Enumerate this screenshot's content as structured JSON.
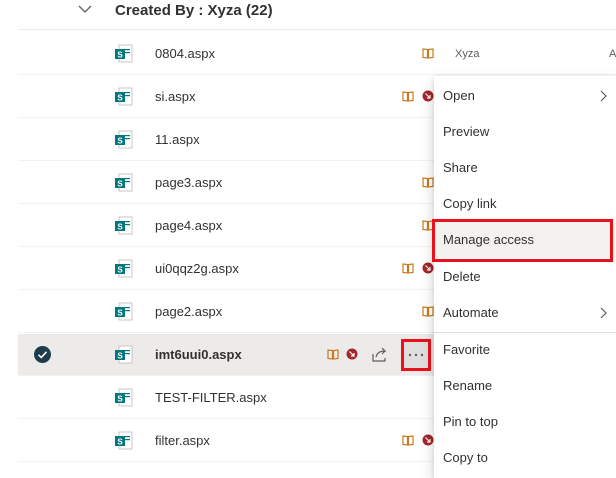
{
  "group": {
    "title": "Created By : Xyza (22)"
  },
  "rows": [
    {
      "name": "0804.aspx",
      "modified_by": "Xyza",
      "col_au": "Au"
    },
    {
      "name": "si.aspx"
    },
    {
      "name": "11.aspx"
    },
    {
      "name": "page3.aspx"
    },
    {
      "name": "page4.aspx"
    },
    {
      "name": "ui0qqz2g.aspx"
    },
    {
      "name": "page2.aspx"
    },
    {
      "name": "imt6uui0.aspx",
      "selected": true
    },
    {
      "name": "TEST-FILTER.aspx"
    },
    {
      "name": "filter.aspx"
    }
  ],
  "context_menu": {
    "items": [
      {
        "label": "Open",
        "has_submenu": true
      },
      {
        "label": "Preview"
      },
      {
        "label": "Share"
      },
      {
        "label": "Copy link"
      },
      {
        "label": "Manage access",
        "highlighted": true
      },
      {
        "label": "Delete"
      },
      {
        "label": "Automate",
        "has_submenu": true
      },
      {
        "label": "Favorite"
      },
      {
        "label": "Rename"
      },
      {
        "label": "Pin to top"
      },
      {
        "label": "Copy to"
      }
    ]
  },
  "icons": {
    "file": "sharepoint-page-icon",
    "book": "book-icon",
    "blocked": "blocked-icon",
    "share": "share-icon",
    "more": "more-options-icon",
    "check": "checkmark-icon",
    "chevron": "chevron-down-icon"
  },
  "colors": {
    "highlight_red": "#e8111c",
    "file_icon_teal": "#03787c",
    "book_orange": "#c87a1e",
    "blocked_red": "#a4262c"
  }
}
